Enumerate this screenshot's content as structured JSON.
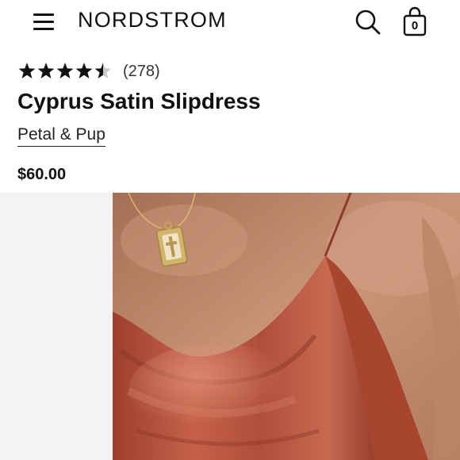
{
  "header": {
    "brand": "NORDSTROM",
    "menu_icon": "hamburger-menu-icon",
    "search_icon": "search-icon",
    "bag_icon": "shopping-bag-icon",
    "bag_count": "0"
  },
  "product": {
    "rating": 4.5,
    "rating_max": 5,
    "review_count": "(278)",
    "title": "Cyprus Satin Slipdress",
    "brand": "Petal & Pup",
    "price": "$60.00"
  },
  "image": {
    "subject": "rust satin slip dress with gold pendant necklace",
    "dress_color": "#b5503a",
    "skin_color": "#c98f72"
  },
  "colors": {
    "text": "#111111",
    "star": "#111111",
    "star_empty": "#c8c8c8",
    "gallery_bg": "#f3f3f3"
  }
}
